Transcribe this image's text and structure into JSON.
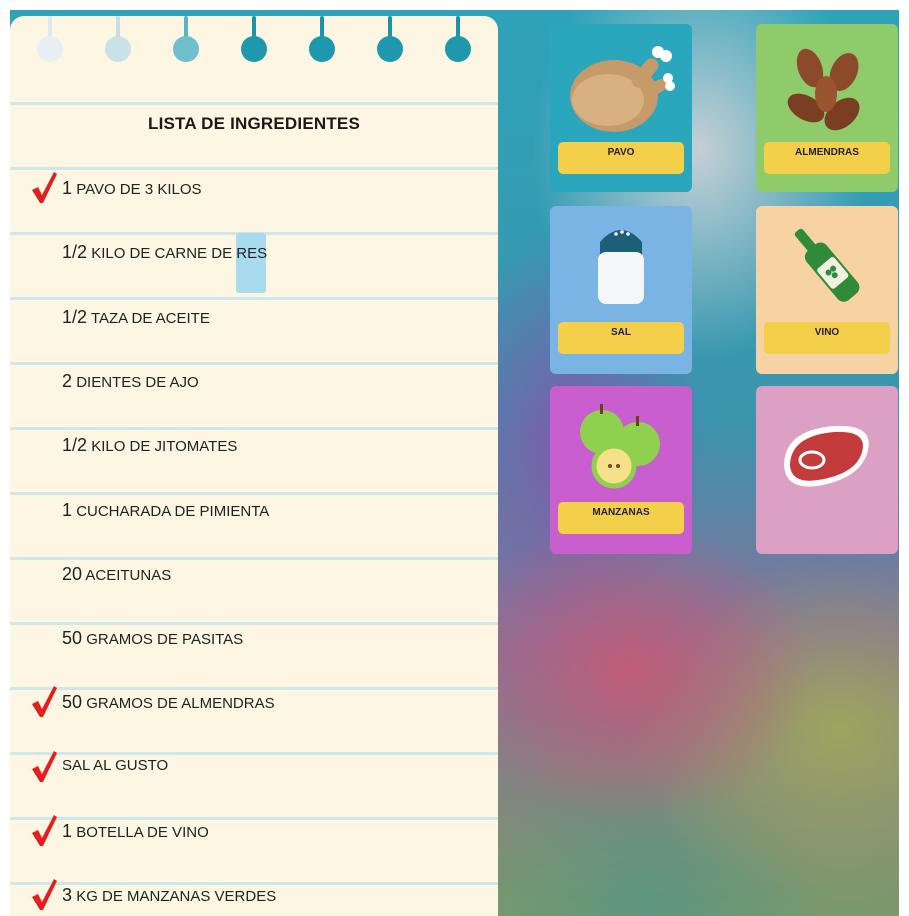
{
  "notebook": {
    "title": "LISTA DE INGREDIENTES",
    "items": [
      {
        "num": "1",
        "text": "PAVO DE 3 KILOS",
        "checked": true
      },
      {
        "num": "1/2",
        "text": "KILO DE CARNE  DE RES",
        "checked": false
      },
      {
        "num": "1/2",
        "text": "TAZA  DE ACEITE",
        "checked": false
      },
      {
        "num": "2",
        "text": "DIENTES  DE AJO",
        "checked": false
      },
      {
        "num": "1/2",
        "text": "KILO DE JITOMATES",
        "checked": false
      },
      {
        "num": "1",
        "text": "CUCHARADA  DE PIMIENTA",
        "checked": false
      },
      {
        "num": "20",
        "text": "ACEITUNAS",
        "checked": false
      },
      {
        "num": "50",
        "text": "GRAMOS DE PASITAS",
        "checked": false
      },
      {
        "num": "50",
        "text": "GRAMOS DE ALMENDRAS",
        "checked": true
      },
      {
        "num": "",
        "text": "SAL AL GUSTO",
        "checked": true
      },
      {
        "num": "1",
        "text": "BOTELLA  DE VINO",
        "checked": true
      },
      {
        "num": "3",
        "text": "KG DE MANZANAS VERDES",
        "checked": true
      }
    ]
  },
  "cards": [
    {
      "label": "PAVO",
      "icon": "turkey-icon",
      "bg": "#2aa6bd"
    },
    {
      "label": "ALMENDRAS",
      "icon": "almonds-icon",
      "bg": "#8fcb6a"
    },
    {
      "label": "SAL",
      "icon": "salt-shaker-icon",
      "bg": "#7ab4e4"
    },
    {
      "label": "VINO",
      "icon": "wine-bottle-icon",
      "bg": "#f7d3a4"
    },
    {
      "label": "MANZANAS",
      "icon": "apples-icon",
      "bg": "#c95fcf"
    },
    {
      "label": "",
      "icon": "steak-icon",
      "bg": "#dba0c4"
    }
  ],
  "colors": {
    "check": "#e41d1d",
    "label": "#f4cf4a",
    "paper": "#fdf6e3"
  }
}
